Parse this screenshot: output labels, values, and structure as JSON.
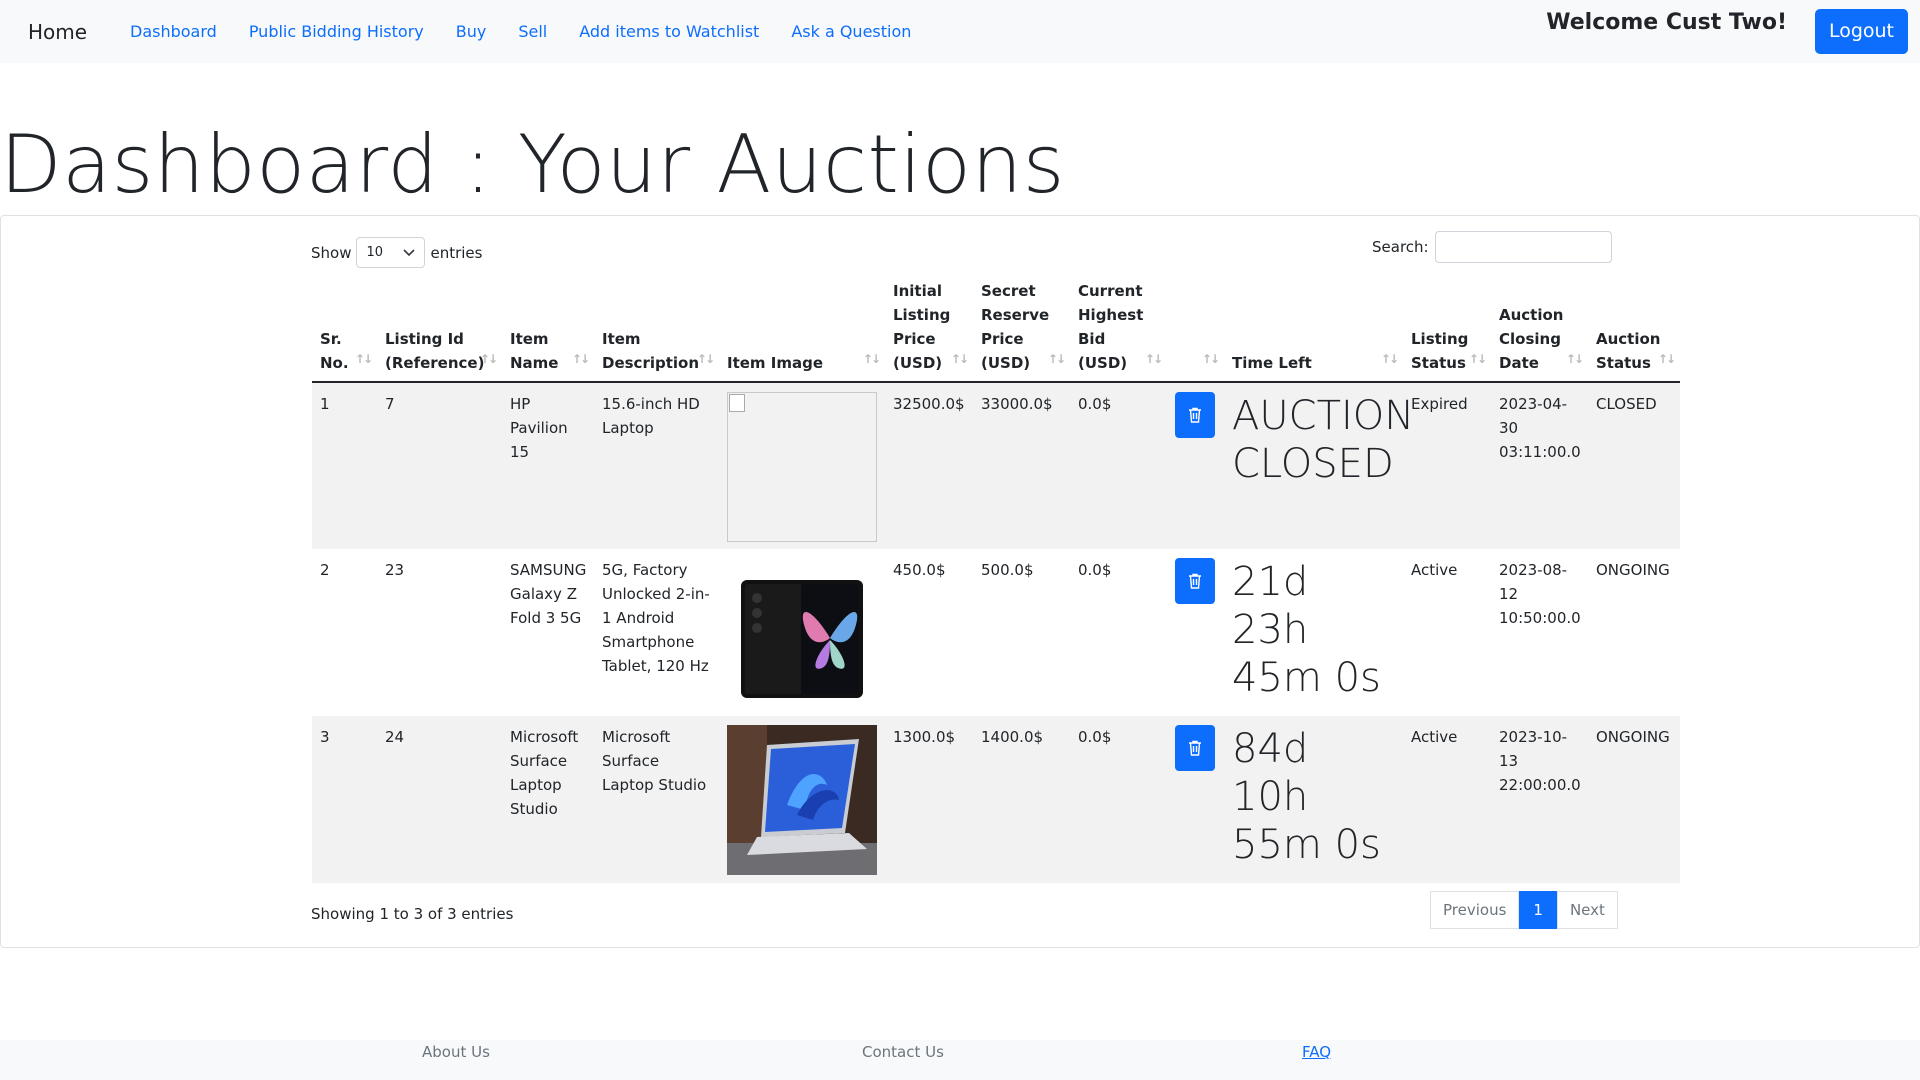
{
  "nav": {
    "brand": "Home",
    "links": [
      "Dashboard",
      "Public Bidding History",
      "Buy",
      "Sell",
      "Add items to Watchlist",
      "Ask a Question"
    ],
    "welcome": "Welcome Cust Two!",
    "logout": "Logout"
  },
  "page": {
    "title": "Dashboard : Your Auctions"
  },
  "table_controls": {
    "show_label": "Show",
    "entries_label": "entries",
    "page_size": "10",
    "search_label": "Search:",
    "search_value": ""
  },
  "columns": [
    "Sr. No.",
    "Listing Id (Reference)",
    "Item Name",
    "Item Description",
    "Item Image",
    "Initial Listing Price (USD)",
    "Secret Reserve Price (USD)",
    "Current Highest Bid (USD)",
    "",
    "Time Left",
    "Listing Status",
    "Auction Closing Date",
    "Auction Status"
  ],
  "rows": [
    {
      "sr": "1",
      "listing_id": "7",
      "name": "HP Pavilion 15",
      "description": "15.6-inch HD Laptop",
      "image": "broken-image-icon",
      "initial_price": "32500.0$",
      "reserve_price": "33000.0$",
      "highest_bid": "0.0$",
      "time_left": "AUCTION CLOSED",
      "listing_status": "Expired",
      "closing_date": "2023-04-30 03:11:00.0",
      "auction_status": "CLOSED"
    },
    {
      "sr": "2",
      "listing_id": "23",
      "name": "SAMSUNG Galaxy Z Fold 3 5G",
      "description": "5G, Factory Unlocked 2-in-1 Android Smartphone Tablet, 120 Hz",
      "image": "foldable-phone-photo",
      "initial_price": "450.0$",
      "reserve_price": "500.0$",
      "highest_bid": "0.0$",
      "time_left": "21d 23h 45m 0s",
      "listing_status": "Active",
      "closing_date": "2023-08-12 10:50:00.0",
      "auction_status": "ONGOING"
    },
    {
      "sr": "3",
      "listing_id": "24",
      "name": "Microsoft Surface Laptop Studio",
      "description": "Microsoft Surface Laptop Studio",
      "image": "laptop-photo",
      "initial_price": "1300.0$",
      "reserve_price": "1400.0$",
      "highest_bid": "0.0$",
      "time_left": "84d 10h 55m 0s",
      "listing_status": "Active",
      "closing_date": "2023-10-13 22:00:00.0",
      "auction_status": "ONGOING"
    }
  ],
  "footer_info": "Showing 1 to 3 of 3 entries",
  "pagination": {
    "previous": "Previous",
    "current": "1",
    "next": "Next"
  },
  "footer": {
    "about": "About Us",
    "contact": "Contact Us",
    "faq": "FAQ"
  },
  "colors": {
    "primary": "#0d6efd",
    "navbar_bg": "#f8f9fa",
    "stripe": "#f2f2f2"
  }
}
